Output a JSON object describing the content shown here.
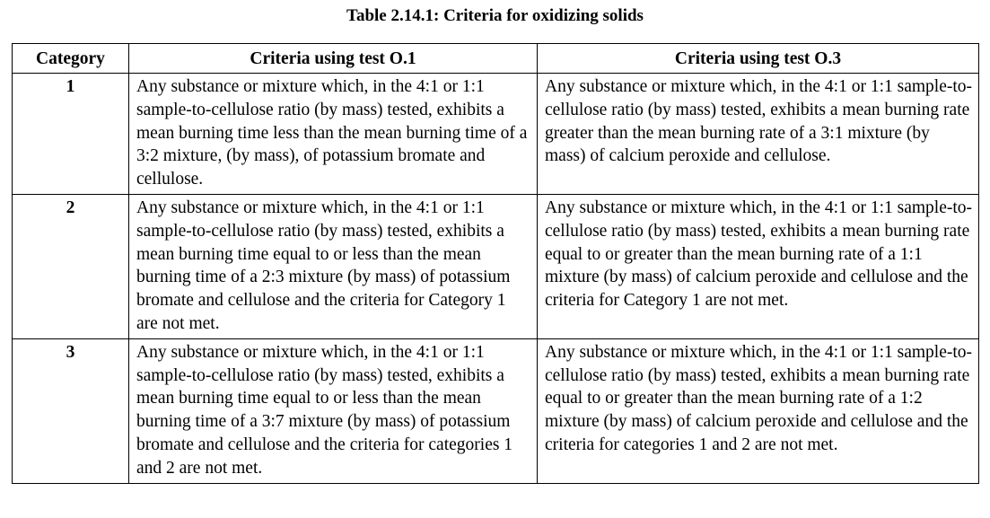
{
  "caption": "Table 2.14.1: Criteria for oxidizing solids",
  "headers": {
    "category": "Category",
    "o1": "Criteria using test O.1",
    "o3": "Criteria using test O.3"
  },
  "rows": [
    {
      "category": "1",
      "o1": "Any substance or mixture which, in the 4:1 or 1:1 sample-to-cellulose ratio (by mass) tested, exhibits a mean burning time less than the mean burning time of a 3:2 mixture, (by mass), of potassium bromate and cellulose.",
      "o3": "Any substance or mixture which, in the 4:1 or 1:1 sample-to-cellulose ratio (by mass) tested, exhibits a mean burning rate greater than the mean burning rate of a 3:1 mixture (by mass) of calcium peroxide and cellulose."
    },
    {
      "category": "2",
      "o1": "Any substance or mixture which, in the 4:1 or 1:1 sample-to-cellulose ratio (by mass) tested, exhibits a mean burning time equal to or less than the mean burning time of a 2:3 mixture (by mass) of potassium bromate and cellulose and the criteria for Category 1 are not met.",
      "o3": "Any substance or mixture which, in the 4:1 or 1:1 sample-to-cellulose ratio (by mass) tested, exhibits a mean burning rate equal to or greater than the mean burning rate of a 1:1 mixture (by mass) of calcium peroxide and cellulose and the criteria for Category 1 are not met."
    },
    {
      "category": "3",
      "o1": "Any substance or mixture which, in the 4:1 or 1:1 sample-to-cellulose ratio (by mass) tested, exhibits a mean burning time equal to or less than the mean burning time of a 3:7 mixture (by mass) of potassium bromate and cellulose and the criteria for categories 1 and 2 are not met.",
      "o3": "Any substance or mixture which, in the 4:1 or 1:1 sample-to-cellulose ratio (by mass) tested, exhibits a mean burning rate equal to or greater than the mean burning rate of a 1:2 mixture (by mass) of calcium peroxide and cellulose and the criteria for categories 1 and 2 are not met."
    }
  ]
}
